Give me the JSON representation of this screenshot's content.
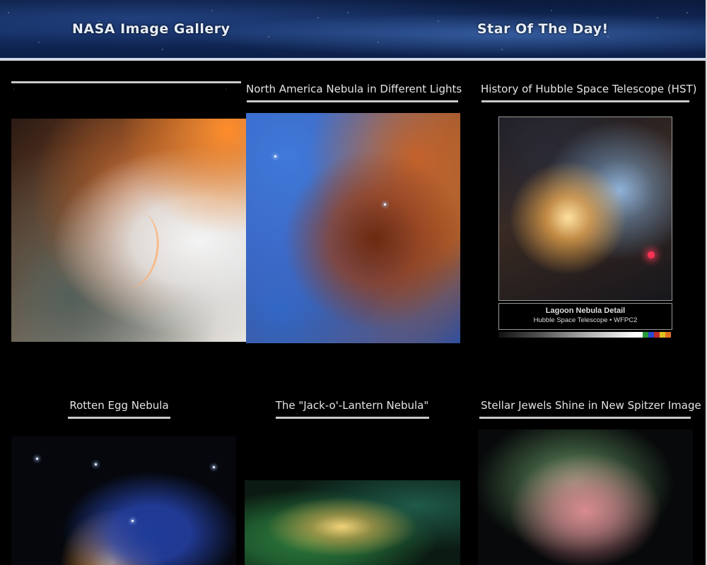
{
  "header": {
    "gallery_title": "NASA Image Gallery",
    "star_of_day": "Star Of The Day!"
  },
  "gallery": {
    "items": [
      {
        "caption": ""
      },
      {
        "caption": "North America Nebula in Different Lights"
      },
      {
        "caption": "History of Hubble Space Telescope (HST)"
      },
      {
        "caption": "Rotten Egg Nebula"
      },
      {
        "caption": "The \"Jack-o'-Lantern Nebula\""
      },
      {
        "caption": "Stellar Jewels Shine in New Spitzer Image"
      }
    ],
    "hubble_label": {
      "title": "Lagoon Nebula Detail",
      "subtitle": "Hubble Space Telescope • WFPC2"
    }
  },
  "colors": {
    "background": "#000000",
    "caption_text": "#e4e4e4",
    "underline": "#c9c9c9",
    "header_bar": "#cfd6e2"
  }
}
